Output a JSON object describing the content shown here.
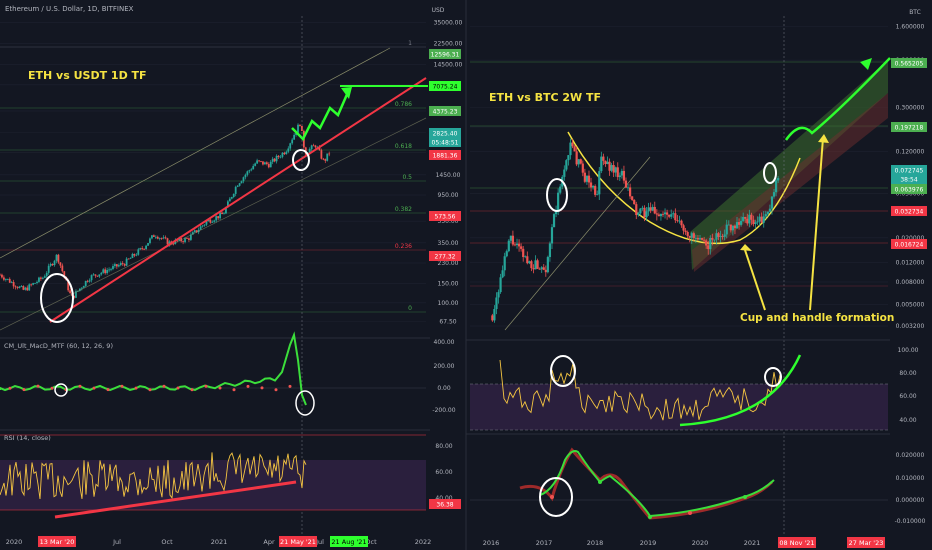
{
  "colors": {
    "background": "#131722",
    "grid": "#1e2230",
    "candle_up": "#26a69a",
    "candle_down": "#ef5350",
    "accent_yellow": "#f5e342",
    "annot_green": "#2eff2e",
    "trend_red": "#f23645",
    "fib_green": "#4caf50",
    "rsi_band": "#2a1f3d",
    "macd_line": "#3bde3b"
  },
  "left_panel": {
    "symbol_title": "Ethereum / U.S. Dollar, 1D, BITFINEX",
    "chart_label": "ETH vs USDT 1D TF",
    "currency": "USD",
    "price_ticks": [
      "35000.00",
      "22500.00",
      "14500.00",
      "9500.00",
      "5500.00",
      "3500.00",
      "2300.00",
      "1450.00",
      "950.00",
      "550.00",
      "350.00",
      "230.00",
      "150.00",
      "100.00",
      "67.50"
    ],
    "price_boxes": [
      {
        "label": "12596.31",
        "color": "#4caf50"
      },
      {
        "label": "7075.24",
        "color": "#2eff2e"
      },
      {
        "label": "4375.23",
        "color": "#4caf50"
      },
      {
        "label": "2825.40",
        "color": "#26a69a"
      },
      {
        "label": "05:48:51",
        "color": "#26a69a"
      },
      {
        "label": "1881.36",
        "color": "#f23645"
      },
      {
        "label": "573.56",
        "color": "#f23645"
      },
      {
        "label": "277.32",
        "color": "#f23645"
      }
    ],
    "fib_levels": [
      "1",
      "0.786",
      "0.618",
      "0.5",
      "0.382",
      "0.236",
      "0"
    ],
    "x_ticks": [
      "2020",
      "Jul",
      "Oct",
      "2021",
      "Apr",
      "Jul",
      "Oct",
      "2022"
    ],
    "date_badges": [
      {
        "label": "13 Mar '20",
        "color": "#f23645"
      },
      {
        "label": "21 May '21",
        "color": "#f23645"
      },
      {
        "label": "21 Aug '21",
        "color": "#2eff2e"
      }
    ],
    "macd": {
      "title": "CM_Ult_MacD_MTF (60, 12, 26, 9)",
      "ticks": [
        "400.00",
        "200.00",
        "0.00",
        "-200.00"
      ]
    },
    "rsi": {
      "title": "RSI (14, close)",
      "ticks": [
        "80.00",
        "60.00",
        "40.00"
      ],
      "value_box": "36.38"
    }
  },
  "right_panel": {
    "chart_label": "ETH vs BTC 2W TF",
    "currency": "BTC",
    "price_ticks": [
      "1.600000",
      "0.800000",
      "0.300000",
      "0.200000",
      "0.120000",
      "0.050000",
      "0.020000",
      "0.012000",
      "0.008000",
      "0.005000",
      "0.003200"
    ],
    "price_boxes": [
      {
        "label": "0.565205",
        "color": "#4caf50"
      },
      {
        "label": "0.197218",
        "color": "#4caf50"
      },
      {
        "label": "0.072745",
        "color": "#26a69a"
      },
      {
        "label": "38:54",
        "color": "#26a69a"
      },
      {
        "label": "0.063976",
        "color": "#4caf50"
      },
      {
        "label": "0.032734",
        "color": "#f23645"
      },
      {
        "label": "0.016724",
        "color": "#f23645"
      }
    ],
    "annotation": "Cup and handle formation",
    "x_ticks": [
      "2016",
      "2017",
      "2018",
      "2019",
      "2020",
      "2021"
    ],
    "date_badges": [
      {
        "label": "08 Nov '21",
        "color": "#f23645"
      },
      {
        "label": "27 Mar '23",
        "color": "#f23645"
      }
    ],
    "rsi": {
      "ticks": [
        "100.00",
        "80.00",
        "60.00",
        "40.00"
      ]
    },
    "macd": {
      "ticks": [
        "0.020000",
        "0.010000",
        "0.000000",
        "-0.010000"
      ]
    }
  },
  "chart_data": [
    {
      "type": "candlestick",
      "title": "ETH vs USDT 1D TF",
      "xlabel": "",
      "ylabel": "USD",
      "y_scale": "log",
      "ylim": [
        50,
        40000
      ],
      "x_range": [
        "2019-11-01",
        "2022-01-01"
      ],
      "series": [
        {
          "values": [
            [
              "2019-11-01",
              180
            ],
            [
              "2019-12-15",
              130
            ],
            [
              "2020-01-20",
              170
            ],
            [
              "2020-02-15",
              270
            ],
            [
              "2020-03-13",
              110
            ],
            [
              "2020-04-15",
              170
            ],
            [
              "2020-05-20",
              200
            ],
            [
              "2020-06-20",
              230
            ],
            [
              "2020-07-25",
              320
            ],
            [
              "2020-08-15",
              420
            ],
            [
              "2020-09-10",
              350
            ],
            [
              "2020-10-15",
              380
            ],
            [
              "2020-11-20",
              550
            ],
            [
              "2020-12-20",
              640
            ],
            [
              "2021-01-15",
              1200
            ],
            [
              "2021-02-20",
              1900
            ],
            [
              "2021-03-15",
              1800
            ],
            [
              "2021-04-15",
              2400
            ],
            [
              "2021-05-12",
              4300
            ],
            [
              "2021-05-21",
              2300
            ],
            [
              "2021-06-10",
              2700
            ],
            [
              "2021-06-25",
              1900
            ],
            [
              "2021-07-05",
              2300
            ]
          ]
        }
      ],
      "annotations": [
        "fibonacci",
        "ascending channel",
        "target projection 7075.24"
      ]
    },
    {
      "type": "line",
      "title": "ETH vs BTC 2W TF",
      "xlabel": "",
      "ylabel": "BTC",
      "y_scale": "log",
      "ylim": [
        0.0025,
        2
      ],
      "x_range": [
        "2015-08-01",
        "2023-06-01"
      ],
      "series": [
        {
          "values": [
            [
              "2016-01-01",
              0.004
            ],
            [
              "2016-05-01",
              0.02
            ],
            [
              "2016-09-01",
              0.012
            ],
            [
              "2017-01-01",
              0.011
            ],
            [
              "2017-03-15",
              0.04
            ],
            [
              "2017-06-15",
              0.14
            ],
            [
              "2017-09-15",
              0.075
            ],
            [
              "2017-12-15",
              0.05
            ],
            [
              "2018-01-15",
              0.1
            ],
            [
              "2018-06-01",
              0.075
            ],
            [
              "2018-09-15",
              0.033
            ],
            [
              "2019-01-01",
              0.035
            ],
            [
              "2019-06-01",
              0.03
            ],
            [
              "2019-10-01",
              0.02
            ],
            [
              "2020-01-01",
              0.017
            ],
            [
              "2020-06-01",
              0.025
            ],
            [
              "2020-10-01",
              0.03
            ],
            [
              "2021-01-01",
              0.028
            ],
            [
              "2021-03-01",
              0.032
            ],
            [
              "2021-05-10",
              0.0727
            ]
          ]
        }
      ],
      "annotations": [
        "Cup and handle formation"
      ]
    }
  ]
}
